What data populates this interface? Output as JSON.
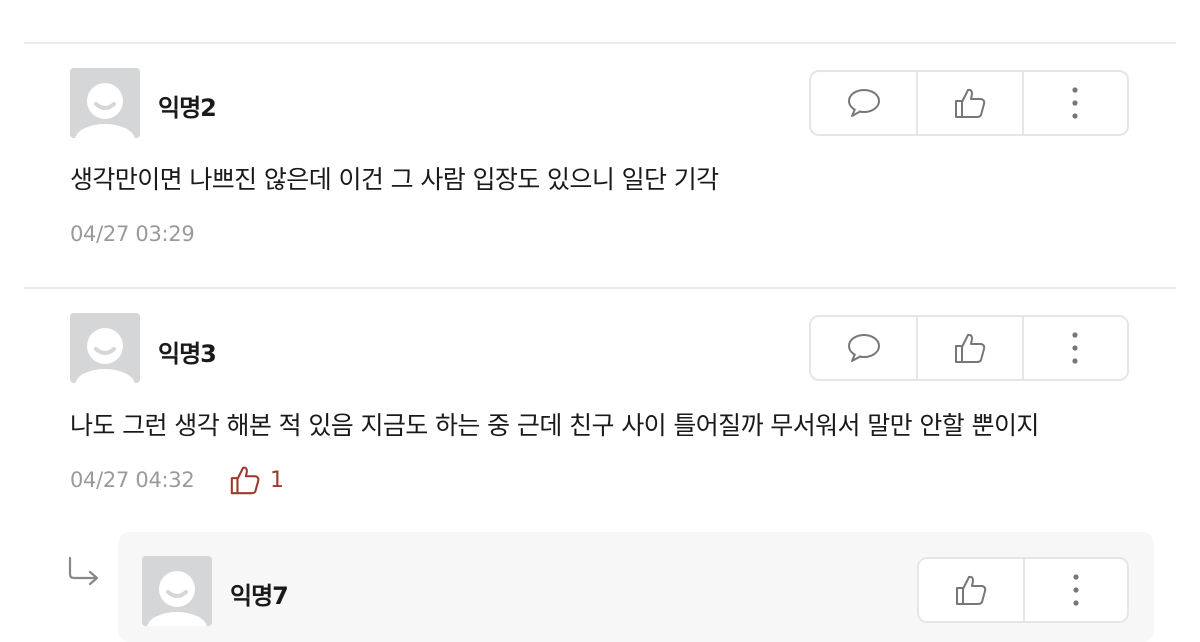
{
  "comments": [
    {
      "nickname": "익명2",
      "text": "생각만이면 나쁘진 않은데 이건 그 사람 입장도 있으니 일단 기각",
      "time": "04/27 03:29"
    },
    {
      "nickname": "익명3",
      "text": "나도 그런 생각 해본 적 있음 지금도 하는 중 근데 친구 사이 틀어질까 무서워서 말만 안할 뿐이지",
      "time": "04/27 04:32",
      "likes": "1"
    }
  ],
  "reply": {
    "nickname": "익명7"
  },
  "colors": {
    "like_accent": "#a0392d",
    "time_gray": "#9a9a9a",
    "border": "#e6e6e6",
    "avatar_bg": "#d5d6d7",
    "reply_bg": "#f7f7f7"
  },
  "icons": {
    "comment": "speech-bubble-icon",
    "like": "thumbs-up-icon",
    "more": "vertical-dots-icon",
    "reply": "reply-arrow-icon",
    "avatar": "default-avatar-icon"
  }
}
